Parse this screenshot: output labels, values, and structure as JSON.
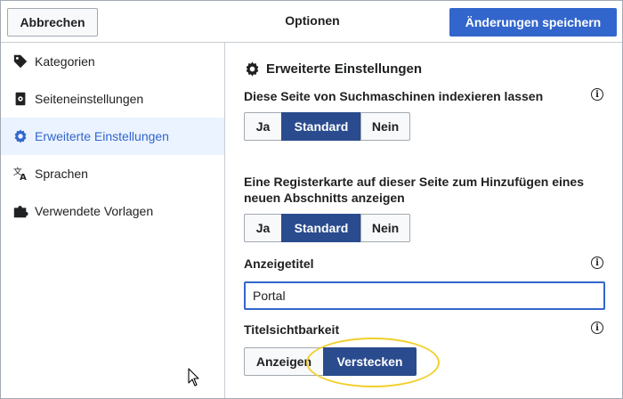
{
  "header": {
    "cancel_label": "Abbrechen",
    "title": "Optionen",
    "save_label": "Änderungen speichern"
  },
  "sidebar": {
    "items": [
      {
        "label": "Kategorien",
        "icon": "tag-icon"
      },
      {
        "label": "Seiteneinstellungen",
        "icon": "page-settings-icon"
      },
      {
        "label": "Erweiterte Einstellungen",
        "icon": "gear-icon",
        "active": true
      },
      {
        "label": "Sprachen",
        "icon": "language-icon"
      },
      {
        "label": "Verwendete Vorlagen",
        "icon": "puzzle-icon"
      }
    ]
  },
  "main": {
    "section_title": "Erweiterte Einstellungen",
    "indexing": {
      "label": "Diese Seite von Suchmaschinen indexieren lassen",
      "options": [
        "Ja",
        "Standard",
        "Nein"
      ],
      "selected": "Standard"
    },
    "new_section_tab": {
      "label_line1": "Eine Registerkarte auf dieser Seite zum Hinzufügen eines",
      "label_line2": "neuen Abschnitts anzeigen",
      "options": [
        "Ja",
        "Standard",
        "Nein"
      ],
      "selected": "Standard"
    },
    "display_title": {
      "label": "Anzeigetitel",
      "value": "Portal"
    },
    "title_visibility": {
      "label": "Titelsichtbarkeit",
      "options": [
        "Anzeigen",
        "Verstecken"
      ],
      "selected": "Verstecken"
    },
    "info_glyph": "i"
  },
  "colors": {
    "accent": "#3366cc",
    "selected": "#2a4b8d",
    "active_bg": "#eaf3ff",
    "highlight_ring": "#f2cf2a"
  }
}
